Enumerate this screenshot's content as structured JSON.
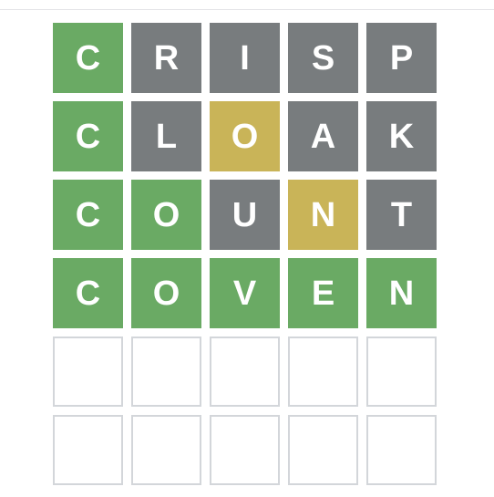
{
  "colors": {
    "correct": "#6aaa64",
    "present": "#c9b458",
    "absent": "#787c7e",
    "empty_border": "#d3d6da"
  },
  "board": {
    "rows": [
      {
        "word": "CRISP",
        "tiles": [
          {
            "letter": "C",
            "state": "correct"
          },
          {
            "letter": "R",
            "state": "absent"
          },
          {
            "letter": "I",
            "state": "absent"
          },
          {
            "letter": "S",
            "state": "absent"
          },
          {
            "letter": "P",
            "state": "absent"
          }
        ]
      },
      {
        "word": "CLOAK",
        "tiles": [
          {
            "letter": "C",
            "state": "correct"
          },
          {
            "letter": "L",
            "state": "absent"
          },
          {
            "letter": "O",
            "state": "present"
          },
          {
            "letter": "A",
            "state": "absent"
          },
          {
            "letter": "K",
            "state": "absent"
          }
        ]
      },
      {
        "word": "COUNT",
        "tiles": [
          {
            "letter": "C",
            "state": "correct"
          },
          {
            "letter": "O",
            "state": "correct"
          },
          {
            "letter": "U",
            "state": "absent"
          },
          {
            "letter": "N",
            "state": "present"
          },
          {
            "letter": "T",
            "state": "absent"
          }
        ]
      },
      {
        "word": "COVEN",
        "tiles": [
          {
            "letter": "C",
            "state": "correct"
          },
          {
            "letter": "O",
            "state": "correct"
          },
          {
            "letter": "V",
            "state": "correct"
          },
          {
            "letter": "E",
            "state": "correct"
          },
          {
            "letter": "N",
            "state": "correct"
          }
        ]
      },
      {
        "word": "",
        "tiles": [
          {
            "letter": "",
            "state": "empty"
          },
          {
            "letter": "",
            "state": "empty"
          },
          {
            "letter": "",
            "state": "empty"
          },
          {
            "letter": "",
            "state": "empty"
          },
          {
            "letter": "",
            "state": "empty"
          }
        ]
      },
      {
        "word": "",
        "tiles": [
          {
            "letter": "",
            "state": "empty"
          },
          {
            "letter": "",
            "state": "empty"
          },
          {
            "letter": "",
            "state": "empty"
          },
          {
            "letter": "",
            "state": "empty"
          },
          {
            "letter": "",
            "state": "empty"
          }
        ]
      }
    ]
  }
}
